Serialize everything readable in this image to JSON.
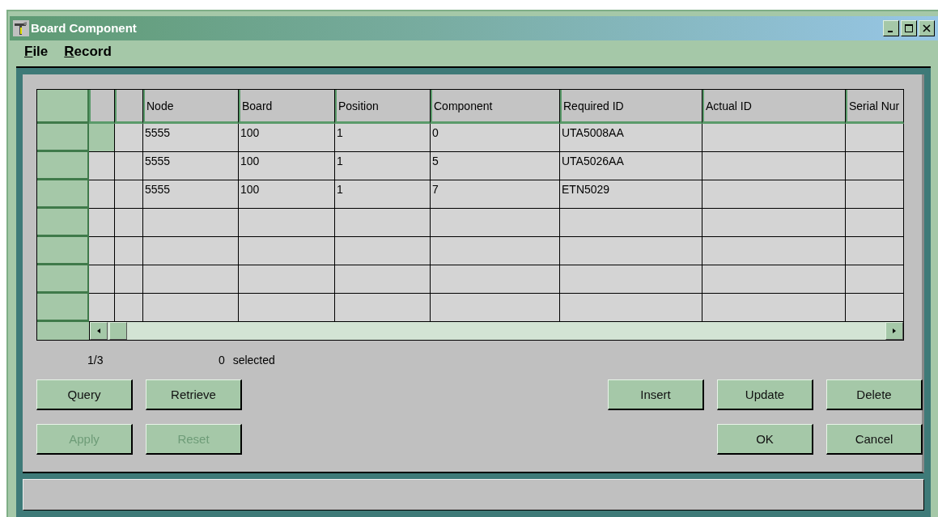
{
  "window": {
    "title": "Board Component"
  },
  "menu": [
    {
      "label": "File"
    },
    {
      "label": "Record"
    }
  ],
  "table": {
    "columns": [
      "Node",
      "Board",
      "Position",
      "Component",
      "Required ID",
      "Actual ID",
      "Serial Nur"
    ],
    "rows": [
      {
        "selected": true,
        "cells": [
          "5555",
          "100",
          "1",
          "0",
          "UTA5008AA"
        ]
      },
      {
        "selected": false,
        "cells": [
          "5555",
          "100",
          "1",
          "5",
          "UTA5026AA"
        ]
      },
      {
        "selected": false,
        "cells": [
          "5555",
          "100",
          "1",
          "7",
          "ETN5029"
        ]
      },
      {
        "selected": false
      },
      {
        "selected": false
      },
      {
        "selected": false
      },
      {
        "selected": false
      }
    ]
  },
  "record_counter": "1/3",
  "selection_count": "0 selected",
  "buttons_left": [
    [
      {
        "label": "Query",
        "disabled": false
      },
      {
        "label": "Retrieve",
        "disabled": false
      }
    ],
    [
      {
        "label": "Apply",
        "disabled": true
      },
      {
        "label": "Reset",
        "disabled": true
      }
    ]
  ],
  "buttons_right": [
    [
      {
        "label": "Insert",
        "disabled": false
      },
      {
        "label": "Update",
        "disabled": false
      },
      {
        "label": "Delete",
        "disabled": false
      }
    ],
    [
      {
        "label": "OK",
        "disabled": false
      },
      {
        "label": "Cancel",
        "disabled": false
      }
    ]
  ]
}
